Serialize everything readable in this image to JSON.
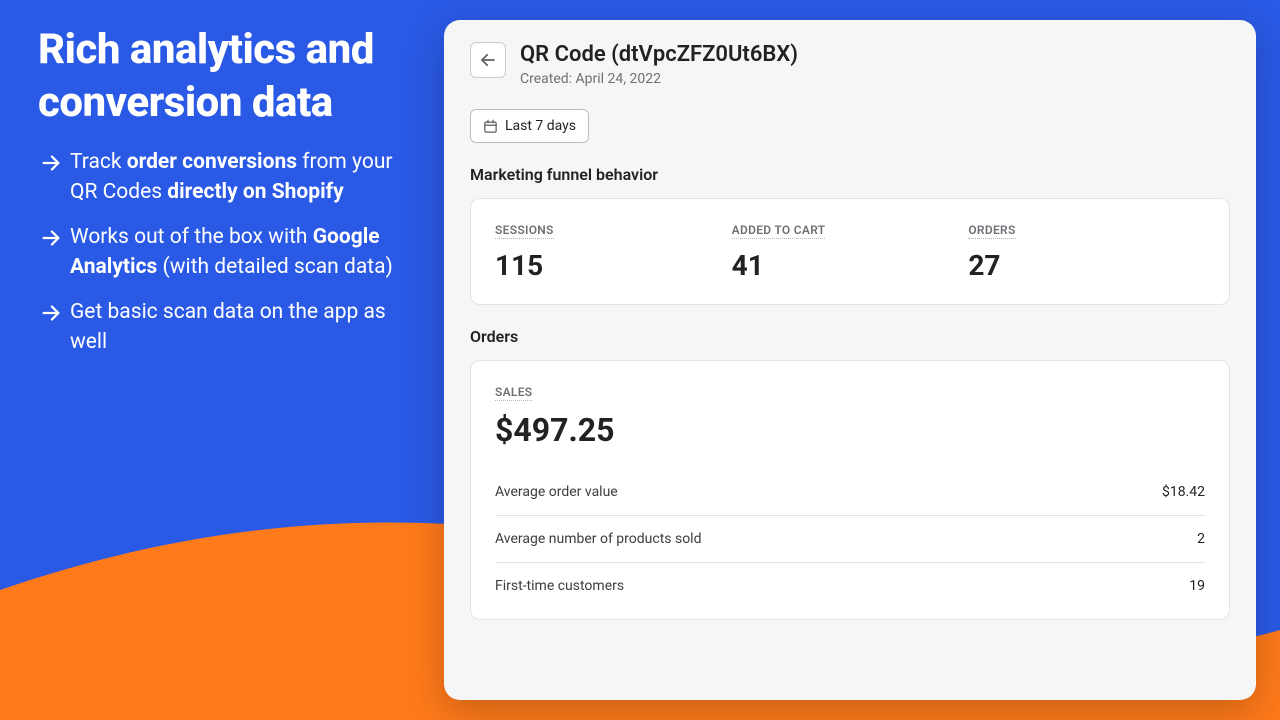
{
  "hero": {
    "headline": "Rich analytics and conversion data",
    "bullets": [
      {
        "pre": "Track ",
        "b1": "order conversions",
        "mid": " from your QR Codes ",
        "b2": "directly on Shopify",
        "post": ""
      },
      {
        "pre": "Works out of the box with ",
        "b1": "Google Analytics",
        "mid": " (with detailed scan data)",
        "b2": "",
        "post": ""
      },
      {
        "pre": "Get basic scan data on the app as well",
        "b1": "",
        "mid": "",
        "b2": "",
        "post": ""
      }
    ]
  },
  "detail": {
    "title": "QR Code (dtVpcZFZ0Ut6BX)",
    "created": "Created: April 24, 2022",
    "date_range": "Last 7 days",
    "funnel": {
      "heading": "Marketing funnel behavior",
      "metrics": [
        {
          "label": "SESSIONS",
          "value": "115"
        },
        {
          "label": "ADDED TO CART",
          "value": "41"
        },
        {
          "label": "ORDERS",
          "value": "27"
        }
      ]
    },
    "orders": {
      "heading": "Orders",
      "sales_label": "SALES",
      "sales_value": "$497.25",
      "rows": [
        {
          "label": "Average order value",
          "value": "$18.42"
        },
        {
          "label": "Average number of products sold",
          "value": "2"
        },
        {
          "label": "First-time customers",
          "value": "19"
        }
      ]
    }
  }
}
